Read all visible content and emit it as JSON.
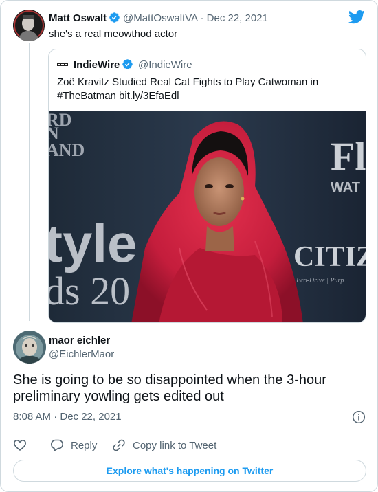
{
  "colors": {
    "accent": "#1d9bf0",
    "text": "#0f1419",
    "muted": "#536471",
    "border": "#cfd9de"
  },
  "icons": [
    "twitter-bird-icon",
    "verified-icon",
    "info-icon",
    "heart-icon",
    "reply-icon",
    "link-icon"
  ],
  "parent_tweet": {
    "author_name": "Matt Oswalt",
    "handle": "@MattOswaltVA",
    "separator": "·",
    "date": "Dec 22, 2021",
    "text": "she's a real meowthod actor"
  },
  "quoted_tweet": {
    "author_name": "IndieWire",
    "handle": "@IndieWire",
    "text_line1": "Zoë Kravitz Studied Real Cat Fights to Play Catwoman in",
    "text_line2": "#TheBatman bit.ly/3EfaEdl",
    "image_bg_text": {
      "left_top": "RD\nN\nAND",
      "style": "tyle",
      "awards": "ds 20",
      "right_top": "Fl",
      "right_sub": "WAT",
      "citizen": "CITIZ"
    }
  },
  "reply_tweet": {
    "author_name": "maor eichler",
    "handle": "@EichlerMaor",
    "text_line1": "She is going to be so disappointed when the 3-hour",
    "text_line2": "preliminary yowling gets edited out",
    "timestamp": "8:08 AM · Dec 22, 2021"
  },
  "actions": {
    "reply_label": "Reply",
    "copy_label": "Copy link to Tweet"
  },
  "explore_label": "Explore what's happening on Twitter"
}
